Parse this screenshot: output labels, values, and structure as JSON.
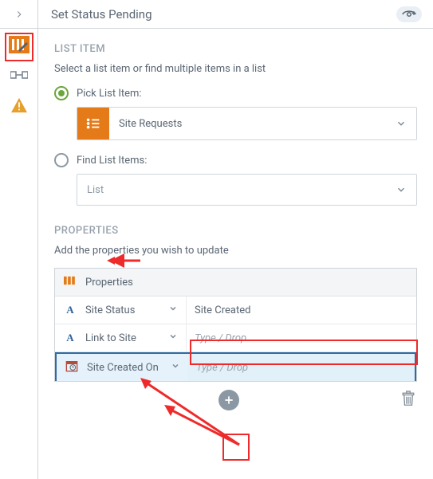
{
  "header": {
    "title": "Set Status Pending"
  },
  "list_item": {
    "heading": "LIST ITEM",
    "description": "Select a list item or find multiple items in a list",
    "pick_label": "Pick List Item:",
    "pick_value": "Site Requests",
    "find_label": "Find List Items:",
    "find_placeholder": "List"
  },
  "properties": {
    "heading": "PROPERTIES",
    "description": "Add the properties you wish to update",
    "table_header": "Properties",
    "rows": [
      {
        "icon": "A",
        "name": "Site Status",
        "value": "Site Created",
        "placeholder": "Type / Drop",
        "filled": true
      },
      {
        "icon": "A",
        "name": "Link to Site",
        "value": "",
        "placeholder": "Type / Drop",
        "filled": false
      },
      {
        "icon": "date",
        "name": "Site Created On",
        "value": "",
        "placeholder": "Type / Drop",
        "filled": false
      }
    ]
  }
}
